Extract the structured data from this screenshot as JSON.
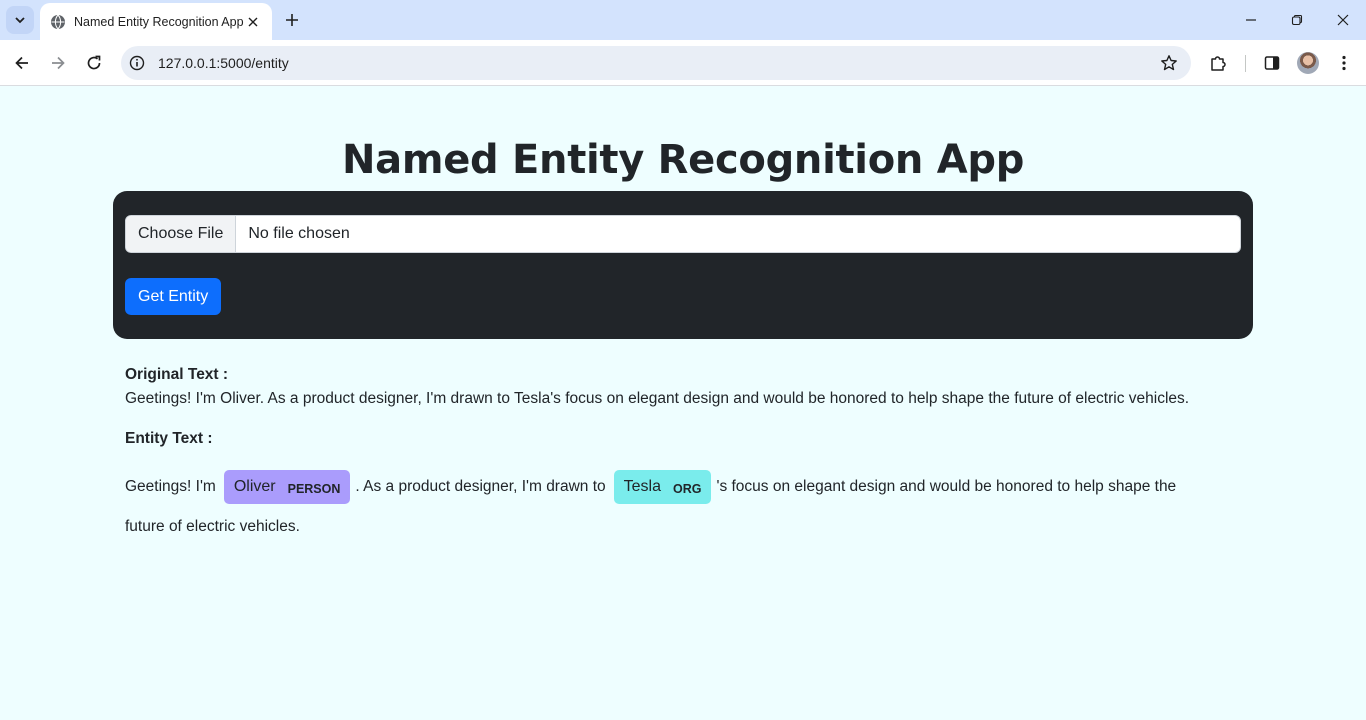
{
  "browser": {
    "tab_title": "Named Entity Recognition App",
    "url": "127.0.0.1:5000/entity"
  },
  "icons": {
    "tab_search": "chevron-down-icon",
    "favicon": "globe-icon",
    "tab_close": "close-icon",
    "new_tab": "plus-icon",
    "back": "arrow-left-icon",
    "forward": "arrow-right-icon",
    "reload": "reload-icon",
    "site_info": "info-icon",
    "bookmark": "star-icon",
    "extensions": "puzzle-icon",
    "side_panel": "side-panel-icon",
    "menu": "kebab-menu-icon"
  },
  "page": {
    "title": "Named Entity Recognition App",
    "file_input": {
      "button_label": "Choose File",
      "status": "No file chosen"
    },
    "submit_label": "Get Entity",
    "original": {
      "label": "Original Text :",
      "text": "Geetings! I'm Oliver. As a product designer, I'm drawn to Tesla's focus on elegant design and would be honored to help shape the future of electric vehicles."
    },
    "entity": {
      "label": "Entity Text :",
      "before_person": "Geetings! I'm",
      "person_text": "Oliver",
      "person_label": "PERSON",
      "between": ". As a product designer, I'm drawn to",
      "org_text": "Tesla",
      "org_label": "ORG",
      "after_org": "'s focus on elegant design and would be honored to help shape the",
      "line2": "future of electric vehicles."
    }
  },
  "colors": {
    "page_background": "#eefeff",
    "card": "#212529",
    "primary_button": "#0d6efd",
    "person_entity": "#aa9cfc",
    "org_entity": "#7aecec"
  }
}
